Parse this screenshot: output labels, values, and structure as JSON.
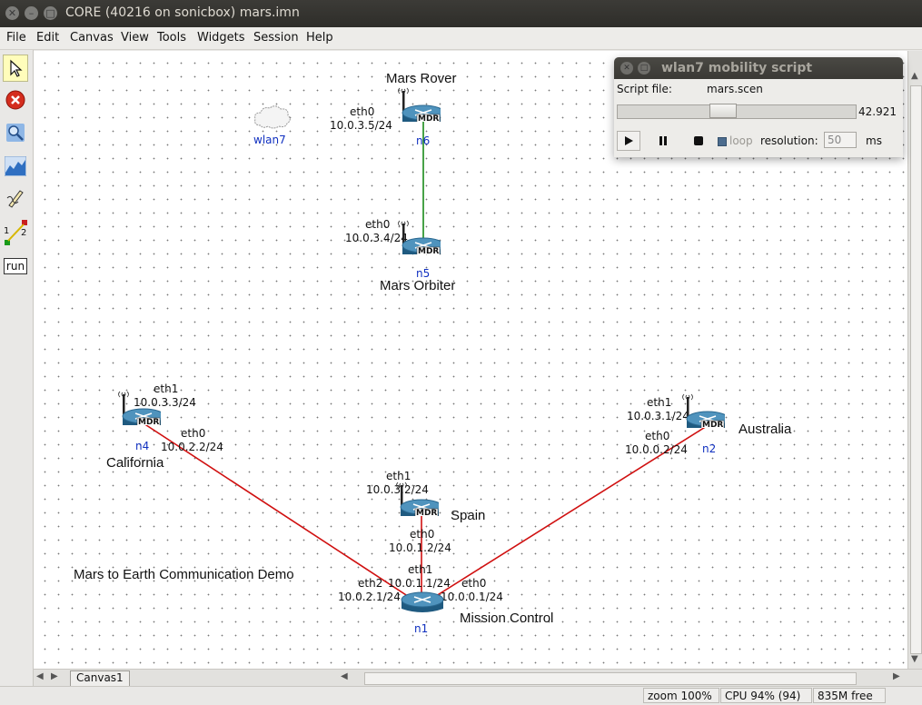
{
  "window": {
    "title": "CORE (40216 on sonicbox) mars.imn"
  },
  "menu": [
    "File",
    "Edit",
    "Canvas",
    "View",
    "Tools",
    "Widgets",
    "Session",
    "Help"
  ],
  "toolbar": {
    "tools": [
      "select-tool",
      "stop-tool",
      "zoom-tool",
      "plot-tool",
      "marker-tool",
      "two-node-tool",
      "run-tool"
    ],
    "link_tool_labels": [
      "1",
      "2"
    ],
    "run_label": "run"
  },
  "canvas": {
    "wlan": {
      "name": "wlan7"
    },
    "demo_title": "Mars to Earth Communication Demo",
    "nodes": {
      "n6": {
        "id": "n6",
        "badge": "MDR",
        "name": "Mars Rover",
        "eth0": "eth0",
        "eth0_ip": "10.0.3.5/24"
      },
      "n5": {
        "id": "n5",
        "badge": "MDR",
        "name": "Mars Orbiter",
        "eth0": "eth0",
        "eth0_ip": "10.0.3.4/24"
      },
      "n4": {
        "id": "n4",
        "badge": "MDR",
        "name": "California",
        "eth1": "eth1",
        "eth1_ip": "10.0.3.3/24",
        "eth0": "eth0",
        "eth0_ip": "10.0.2.2/24"
      },
      "n2": {
        "id": "n2",
        "badge": "MDR",
        "name": "Australia",
        "eth1": "eth1",
        "eth1_ip": "10.0.3.1/24",
        "eth0": "eth0",
        "eth0_ip": "10.0.0.2/24"
      },
      "n3": {
        "badge": "MDR",
        "name": "Spain",
        "eth1": "eth1",
        "eth1_ip": "10.0.3.2/24",
        "eth0": "eth0",
        "eth0_ip": "10.0.1.2/24"
      },
      "n1": {
        "id": "n1",
        "name": "Mission Control",
        "eth1": "eth1",
        "eth1_ip": "10.0.1.1/24",
        "eth2": "eth2",
        "eth2_ip": "10.0.2.1/24",
        "eth0": "eth0",
        "eth0_ip": "10.0.0.1/24"
      }
    }
  },
  "tabs": {
    "canvas_tab": "Canvas1"
  },
  "status": {
    "zoom": "zoom 100%",
    "cpu": "CPU 94% (94)",
    "mem": "835M free"
  },
  "mobility": {
    "title": "wlan7 mobility script",
    "script_label": "Script file:",
    "script_file": "mars.scen",
    "time": "42.921",
    "slider_fraction": 0.44,
    "loop_label": "loop",
    "resolution_label": "resolution:",
    "resolution_value": "50",
    "units": "ms"
  },
  "colors": {
    "wireless_link": "#1a8a1a",
    "wired_link": "#d01010",
    "node_id": "#1030c0",
    "selected_tool": "#fffdbb"
  }
}
